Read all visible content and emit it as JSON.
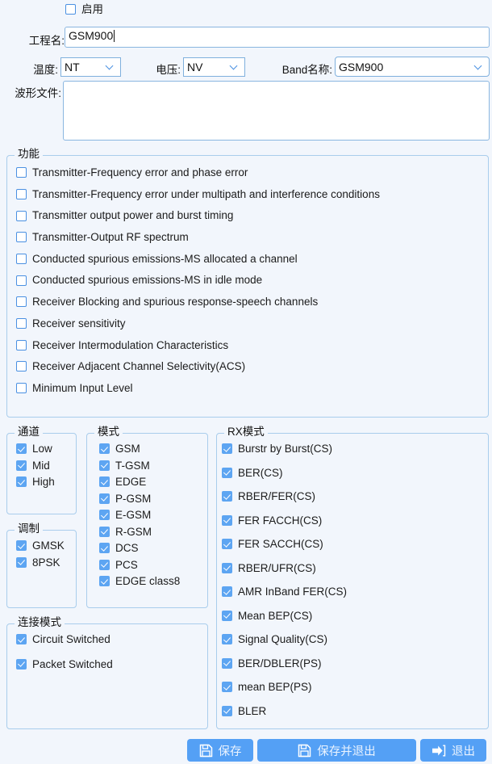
{
  "form": {
    "enable": {
      "label": "启用",
      "checked": false
    },
    "project_name": {
      "label": "工程名:",
      "value": "GSM900"
    },
    "temperature": {
      "label": "温度:",
      "value": "NT"
    },
    "voltage": {
      "label": "电压:",
      "value": "NV"
    },
    "band_name": {
      "label": "Band名称:",
      "value": "GSM900"
    },
    "waveform_file": {
      "label": "波形文件:",
      "value": ""
    }
  },
  "function_group": {
    "legend": "功能",
    "items": [
      {
        "label": "Transmitter-Frequency error and phase error",
        "checked": false
      },
      {
        "label": "Transmitter-Frequency error under multipath and interference conditions",
        "checked": false
      },
      {
        "label": "Transmitter output power and burst timing",
        "checked": false
      },
      {
        "label": "Transmitter-Output RF spectrum",
        "checked": false
      },
      {
        "label": "Conducted spurious emissions-MS allocated a channel",
        "checked": false
      },
      {
        "label": "Conducted spurious emissions-MS in idle mode",
        "checked": false
      },
      {
        "label": "Receiver Blocking and spurious response-speech channels",
        "checked": false
      },
      {
        "label": "Receiver sensitivity",
        "checked": false
      },
      {
        "label": "Receiver Intermodulation Characteristics",
        "checked": false
      },
      {
        "label": "Receiver Adjacent Channel Selectivity(ACS)",
        "checked": false
      },
      {
        "label": "Minimum Input Level",
        "checked": false
      }
    ]
  },
  "channel_group": {
    "legend": "通道",
    "items": [
      {
        "label": "Low",
        "checked": true
      },
      {
        "label": "Mid",
        "checked": true
      },
      {
        "label": "High",
        "checked": true
      }
    ]
  },
  "modulation_group": {
    "legend": "调制",
    "items": [
      {
        "label": "GMSK",
        "checked": true
      },
      {
        "label": "8PSK",
        "checked": true
      }
    ]
  },
  "connection_group": {
    "legend": "连接模式",
    "items": [
      {
        "label": "Circuit Switched",
        "checked": true
      },
      {
        "label": "Packet Switched",
        "checked": true
      }
    ]
  },
  "mode_group": {
    "legend": "模式",
    "items": [
      {
        "label": "GSM",
        "checked": true
      },
      {
        "label": "T-GSM",
        "checked": true
      },
      {
        "label": "EDGE",
        "checked": true
      },
      {
        "label": "P-GSM",
        "checked": true
      },
      {
        "label": "E-GSM",
        "checked": true
      },
      {
        "label": "R-GSM",
        "checked": true
      },
      {
        "label": "DCS",
        "checked": true
      },
      {
        "label": "PCS",
        "checked": true
      },
      {
        "label": "EDGE class8",
        "checked": true
      }
    ]
  },
  "rx_mode_group": {
    "legend": "RX模式",
    "items": [
      {
        "label": "Burstr by Burst(CS)",
        "checked": true
      },
      {
        "label": "BER(CS)",
        "checked": true
      },
      {
        "label": "RBER/FER(CS)",
        "checked": true
      },
      {
        "label": "FER FACCH(CS)",
        "checked": true
      },
      {
        "label": "FER SACCH(CS)",
        "checked": true
      },
      {
        "label": "RBER/UFR(CS)",
        "checked": true
      },
      {
        "label": "AMR InBand FER(CS)",
        "checked": true
      },
      {
        "label": "Mean BEP(CS)",
        "checked": true
      },
      {
        "label": "Signal Quality(CS)",
        "checked": true
      },
      {
        "label": "BER/DBLER(PS)",
        "checked": true
      },
      {
        "label": "mean BEP(PS)",
        "checked": true
      },
      {
        "label": "BLER",
        "checked": true
      }
    ]
  },
  "buttons": {
    "save": {
      "label": "保存",
      "icon": "floppy-disk-icon"
    },
    "save_and_exit": {
      "label": "保存并退出",
      "icon": "floppy-disk-icon"
    },
    "exit": {
      "label": "退出",
      "icon": "exit-arrow-icon"
    }
  },
  "colors": {
    "background": "#f2f6fc",
    "accent": "#54a0f5",
    "border": "#a9cdec",
    "checkbox_on": "#5da5f2"
  }
}
